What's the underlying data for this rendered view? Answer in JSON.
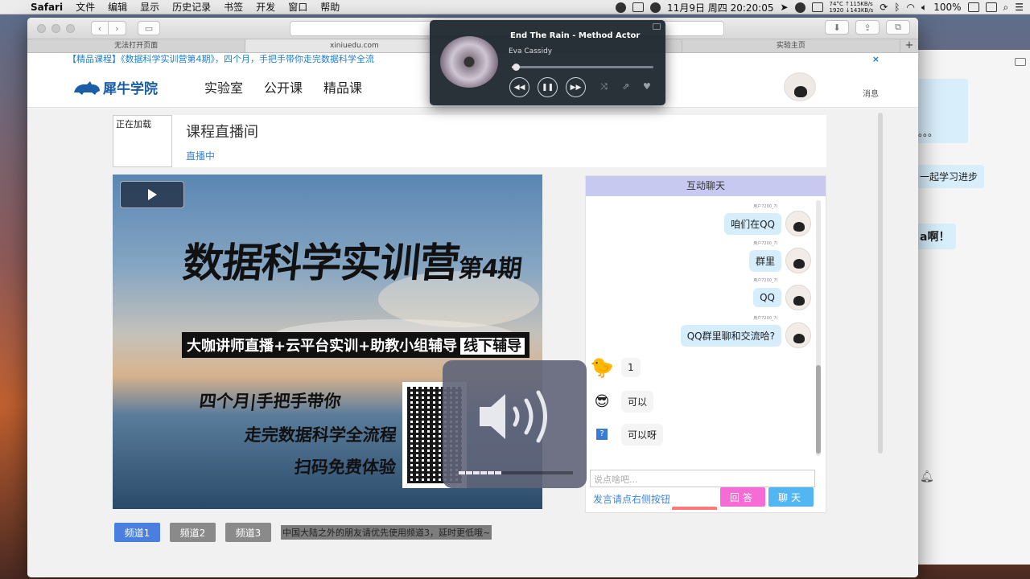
{
  "menubar": {
    "app_name": "Safari",
    "menus": [
      "文件",
      "编辑",
      "显示",
      "历史记录",
      "书签",
      "开发",
      "窗口",
      "帮助"
    ],
    "temperature": "74°C",
    "net_up": "↑115KB/s",
    "resolution": "1920",
    "net_down": "↓143KB/s",
    "datetime": "11月9日 周四  20:20:05",
    "battery": "100%"
  },
  "safari": {
    "address": "xiniuedu.com",
    "tabs": [
      "无法打开页面",
      "",
      "",
      "实验主页"
    ]
  },
  "promo": {
    "text": "【精品课程】《数据科学实训营第4期》，四个月，手把手带你走完数据科学全流",
    "close": "×"
  },
  "site": {
    "logo_text": "犀牛学院",
    "nav": [
      "实验室",
      "公开课",
      "精品课"
    ],
    "message_link": "消息"
  },
  "live": {
    "thumb_text": "正在加载",
    "title": "课程直播间",
    "status": "直播中"
  },
  "poster": {
    "title_main": "数据科学实训营",
    "title_sub": "第4期",
    "band": "大咖讲师直播+云平台实训+助教小组辅导",
    "band_tag": "线下辅导",
    "line1": "四个月|手把手带你",
    "line2": "走完数据科学全流程",
    "line3": "扫码免费体验"
  },
  "channels": {
    "buttons": [
      "频道1",
      "频道2",
      "频道3"
    ],
    "note": "中国大陆之外的朋友请优先使用频道3，延时更低哦~"
  },
  "chat": {
    "header": "互动聊天",
    "username": "用户7200_7l",
    "messages": [
      {
        "side": "right",
        "text": "咱们在QQ"
      },
      {
        "side": "right",
        "text": "群里"
      },
      {
        "side": "right",
        "text": "QQ"
      },
      {
        "side": "right",
        "text": "QQ群里聊和交流哈?"
      },
      {
        "side": "left",
        "text": "1"
      },
      {
        "side": "left",
        "text": "可以"
      },
      {
        "side": "left",
        "text": "可以呀"
      }
    ],
    "input_placeholder": "说点啥吧...",
    "hint": "发言请点右侧按钮",
    "reply_button": "回答",
    "chat_button": "聊天"
  },
  "player": {
    "song": "End The Rain - Method Actor",
    "artist": "Eva Cassidy",
    "progress": 0.03
  },
  "volume": {
    "level": 0.37
  },
  "background_window": {
    "bubbles": [
      "过。。。",
      "一起学习进步",
      "a啊！"
    ]
  },
  "colors": {
    "accent_blue": "#4a7fe0",
    "link_blue": "#3d86d8",
    "chat_header": "#c8c9f0",
    "reply_pink": "#f76bd6",
    "chat_cyan": "#52b6f2"
  }
}
